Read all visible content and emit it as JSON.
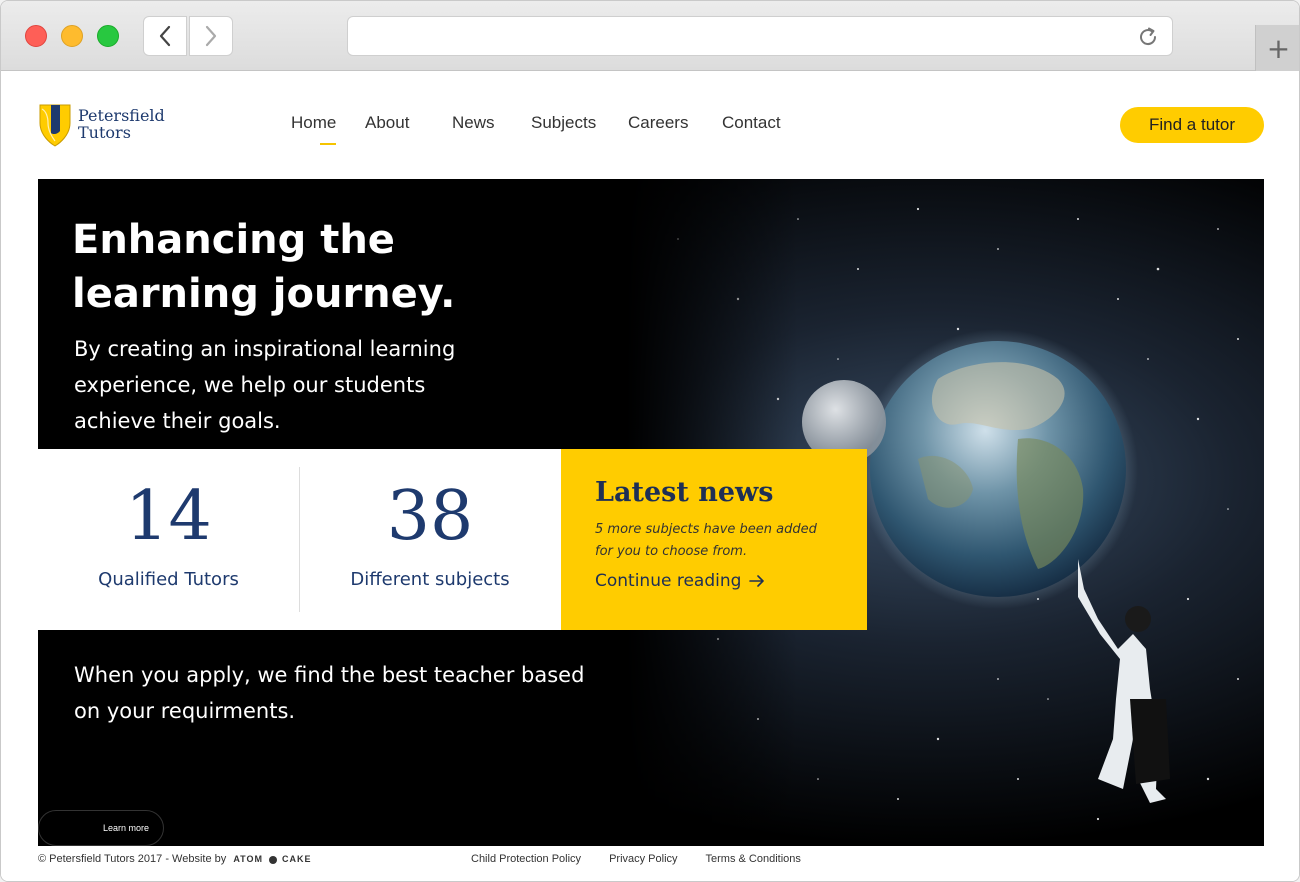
{
  "browser": {
    "url": "",
    "new_tab_symbol": "+"
  },
  "site": {
    "logo": {
      "line1": "Petersfield",
      "line2": "Tutors"
    },
    "nav": [
      {
        "label": "Home",
        "active": true
      },
      {
        "label": "About",
        "active": false
      },
      {
        "label": "News",
        "active": false
      },
      {
        "label": "Subjects",
        "active": false
      },
      {
        "label": "Careers",
        "active": false
      },
      {
        "label": "Contact",
        "active": false
      }
    ],
    "cta_label": "Find a tutor"
  },
  "hero": {
    "headline_line1": "Enhancing the",
    "headline_line2": "learning journey.",
    "subline": "By creating an inspirational learning experience, we help our students achieve their goals.",
    "stats": [
      {
        "value": "14",
        "label": "Qualified Tutors"
      },
      {
        "value": "38",
        "label": "Different subjects"
      }
    ],
    "news": {
      "title": "Latest news",
      "body": "5 more subjects have been added for you to choose from.",
      "link": "Continue reading"
    },
    "apply_text": "When you apply, we find the best teacher based on your requirments.",
    "learn_more": "Learn more"
  },
  "footer": {
    "copyright": "© Petersfield Tutors 2017 - Website by",
    "brand_left": "ATOM",
    "brand_right": "CAKE",
    "links": [
      "Child Protection Policy",
      "Privacy Policy",
      "Terms & Conditions"
    ]
  },
  "colors": {
    "accent": "#ffcc00",
    "navy": "#1e3a6e"
  }
}
